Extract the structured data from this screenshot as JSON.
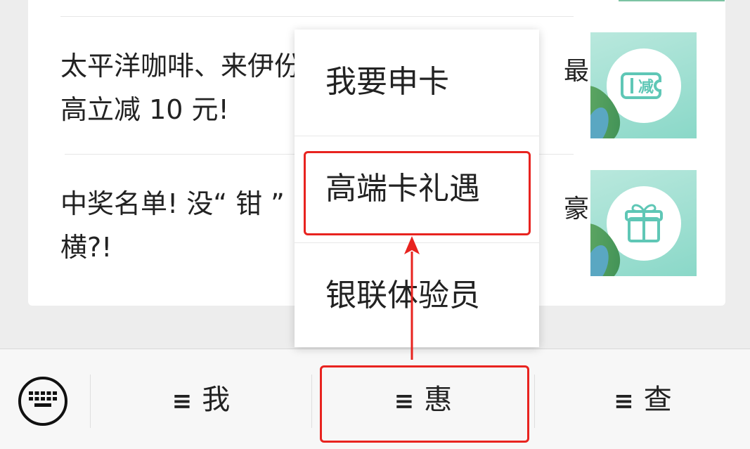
{
  "articles": [
    {
      "line1": "太平洋咖啡、来伊份",
      "tail": "最",
      "line2": "高立减 10 元!",
      "thumb_icon": "ticket-discount-icon",
      "thumb_icon_text": "减"
    },
    {
      "line1": "中奖名单! 没“ 钳 ”",
      "tail": "豪",
      "line2": "横?!",
      "thumb_icon": "gift-icon"
    }
  ],
  "popup": {
    "items": [
      "我要申卡",
      "高端卡礼遇",
      "银联体验员"
    ]
  },
  "menu": {
    "keyboard_icon": "keyboard-icon",
    "hamburger": "≡",
    "items": [
      "我",
      "惠",
      "查"
    ]
  },
  "annotations": {
    "color": "#e8231f"
  }
}
